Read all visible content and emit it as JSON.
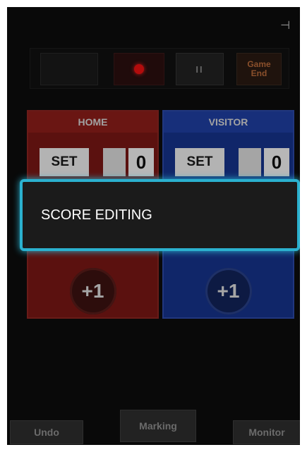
{
  "topbar": {
    "pause_label": "II",
    "end_line1": "Game",
    "end_line2": "End"
  },
  "home": {
    "title": "HOME",
    "set_label": "SET",
    "set_score": "0",
    "plus_label": "+1"
  },
  "visitor": {
    "title": "VISITOR",
    "set_label": "SET",
    "set_score": "0",
    "plus_label": "+1"
  },
  "dialog": {
    "label": "SCORE EDITING",
    "accent": "#2bb1cf"
  },
  "bottom": {
    "undo_label": "Undo",
    "marking_label": "Marking",
    "monitor_label": "Monitor"
  },
  "icons": {
    "plug": "⊣"
  },
  "colors": {
    "home": "#7a1714",
    "visitor": "#16338c",
    "record": "#e11111"
  }
}
